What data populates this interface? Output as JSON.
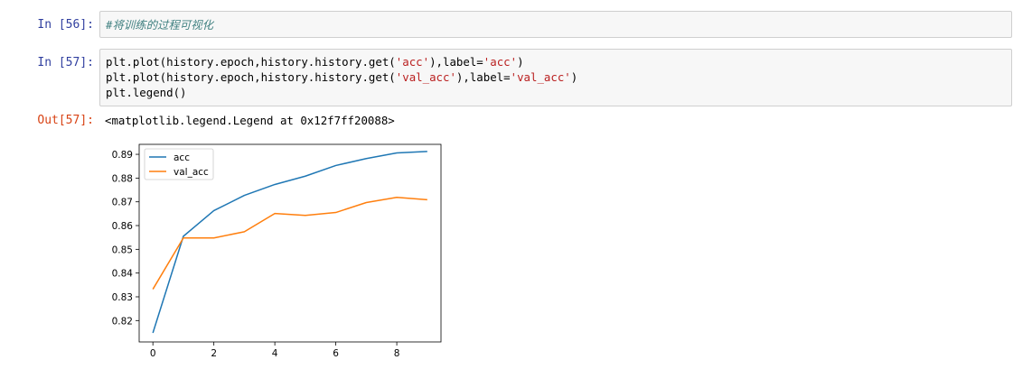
{
  "cells": [
    {
      "prompt": "In  [56]:",
      "comment": "#将训练的过程可视化"
    },
    {
      "prompt": "In  [57]:",
      "lines": [
        {
          "pre": "plt.plot(history.epoch,history.history.get(",
          "s1": "'acc'",
          "mid": "),label=",
          "s2": "'acc'",
          "post": ")"
        },
        {
          "pre": "plt.plot(history.epoch,history.history.get(",
          "s1": "'val_acc'",
          "mid": "),label=",
          "s2": "'val_acc'",
          "post": ")"
        },
        {
          "pre": "plt.legend()",
          "s1": "",
          "mid": "",
          "s2": "",
          "post": ""
        }
      ]
    }
  ],
  "output": {
    "prompt": "Out[57]:",
    "text": "<matplotlib.legend.Legend at 0x12f7ff20088>"
  },
  "chart_data": {
    "type": "line",
    "x": [
      0,
      1,
      2,
      3,
      4,
      5,
      6,
      7,
      8,
      9
    ],
    "series": [
      {
        "name": "acc",
        "color": "#1f77b4",
        "values": [
          0.8148,
          0.8555,
          0.8663,
          0.8727,
          0.8773,
          0.8808,
          0.8853,
          0.8882,
          0.8906,
          0.8912
        ]
      },
      {
        "name": "val_acc",
        "color": "#ff7f0e",
        "values": [
          0.8332,
          0.8548,
          0.8548,
          0.8574,
          0.8651,
          0.8643,
          0.8655,
          0.8697,
          0.8719,
          0.8709
        ]
      }
    ],
    "xlim": [
      -0.45,
      9.45
    ],
    "ylim": [
      0.811,
      0.8942
    ],
    "xticks": [
      0,
      2,
      4,
      6,
      8
    ],
    "yticks": [
      0.82,
      0.83,
      0.84,
      0.85,
      0.86,
      0.87,
      0.88,
      0.89
    ],
    "ytick_labels": [
      "0.82",
      "0.83",
      "0.84",
      "0.85",
      "0.86",
      "0.87",
      "0.88",
      "0.89"
    ],
    "legend_loc": "upper-left",
    "grid": false,
    "title": "",
    "xlabel": "",
    "ylabel": ""
  }
}
